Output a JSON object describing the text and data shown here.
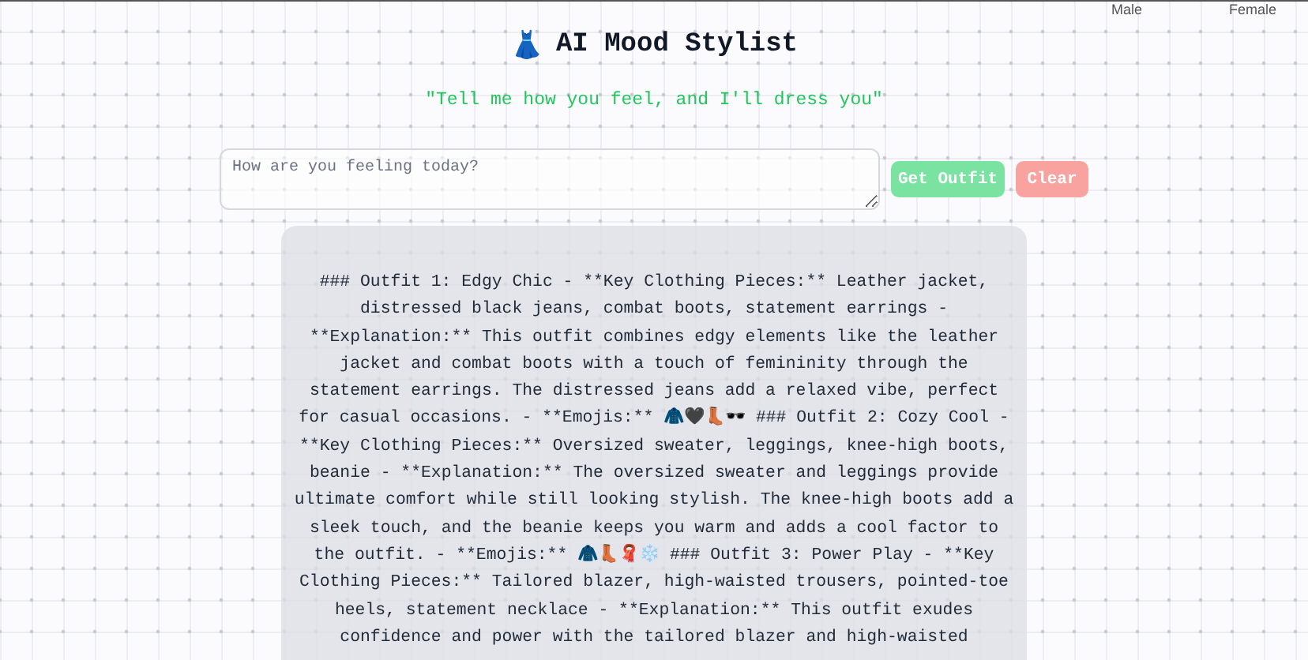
{
  "gender_options": [
    "Male",
    "Female"
  ],
  "header": {
    "icon": "👗",
    "title": "AI Mood Stylist",
    "tagline": "\"Tell me how you feel, and I'll dress you\""
  },
  "mood_input": {
    "placeholder": "How are you feeling today?"
  },
  "buttons": [
    {
      "kind": "primary",
      "label": "Get Outfit"
    },
    {
      "kind": "secondary",
      "label": "Clear"
    }
  ],
  "result": {
    "text": "### Outfit 1: Edgy Chic - **Key Clothing Pieces:** Leather jacket, distressed black jeans, combat boots, statement earrings - **Explanation:** This outfit combines edgy elements like the leather jacket and combat boots with a touch of femininity through the statement earrings. The distressed jeans add a relaxed vibe, perfect for casual occasions. - **Emojis:** 🧥🖤👢🕶️ ### Outfit 2: Cozy Cool - **Key Clothing Pieces:** Oversized sweater, leggings, knee-high boots, beanie - **Explanation:** The oversized sweater and leggings provide ultimate comfort while still looking stylish. The knee-high boots add a sleek touch, and the beanie keeps you warm and adds a cool factor to the outfit. - **Emojis:** 🧥👢🧣❄️ ### Outfit 3: Power Play - **Key Clothing Pieces:** Tailored blazer, high-waisted trousers, pointed-toe heels, statement necklace - **Explanation:** This outfit exudes confidence and power with the tailored blazer and high-waisted"
  }
}
